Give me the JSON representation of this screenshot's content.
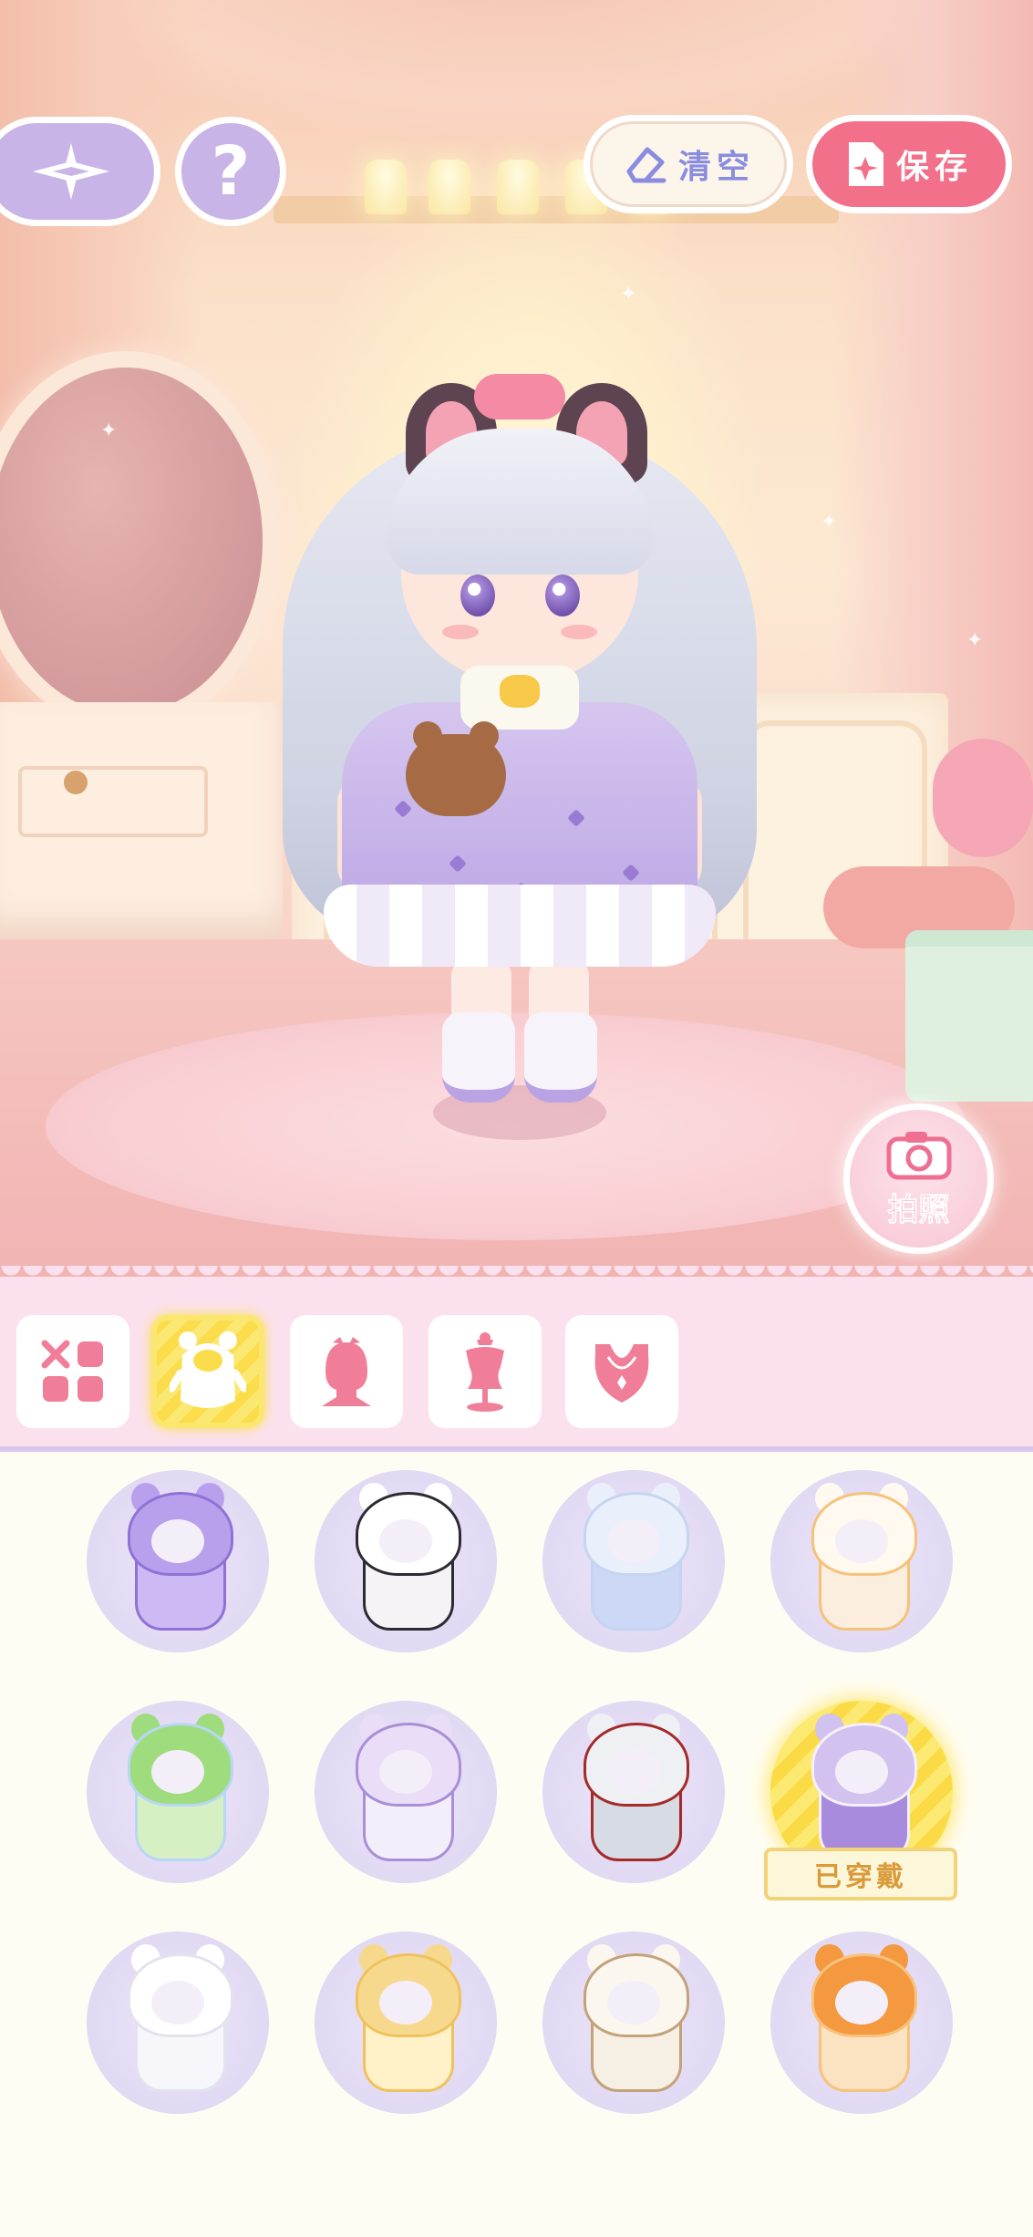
{
  "toolbar": {
    "back_icon": "compass-star-icon",
    "help_label": "?",
    "clear_label": "清空",
    "clear_icon": "eraser-icon",
    "save_label": "保存",
    "save_icon": "document-icon"
  },
  "camera": {
    "label": "拍照",
    "icon": "camera-icon"
  },
  "categories": [
    {
      "name": "all",
      "icon": "grid-icon",
      "active": false
    },
    {
      "name": "costume",
      "icon": "onesie-icon",
      "active": true
    },
    {
      "name": "hair",
      "icon": "hair-bust-icon",
      "active": false
    },
    {
      "name": "dress",
      "icon": "mannequin-icon",
      "active": false
    },
    {
      "name": "accessory",
      "icon": "necklace-bust-icon",
      "active": false
    }
  ],
  "items": [
    {
      "name": "purple-ghost-hood",
      "colors": [
        "#b9a0ec",
        "#8f72d6",
        "#cdb9f4"
      ]
    },
    {
      "name": "panda-magician",
      "colors": [
        "#ffffff",
        "#2d2a33",
        "#f5f3f6"
      ]
    },
    {
      "name": "white-cat-cloak",
      "colors": [
        "#e9f0fb",
        "#c6d5ef",
        "#cdd8f6"
      ]
    },
    {
      "name": "calico-cat-onesie",
      "colors": [
        "#fff9f0",
        "#f6c27a",
        "#fbeedf"
      ]
    },
    {
      "name": "frog-onesie",
      "colors": [
        "#9fdc7e",
        "#b8d7f4",
        "#d6f0c3"
      ]
    },
    {
      "name": "hamster-onesie",
      "colors": [
        "#e9ddf7",
        "#a98fd7",
        "#f3effa"
      ]
    },
    {
      "name": "red-hood-wolf",
      "colors": [
        "#eef0f4",
        "#a52a2a",
        "#d7dbe3"
      ]
    },
    {
      "name": "lolita-dress",
      "colors": [
        "#d2c2ef",
        "#f6f0fb",
        "#a88bdc"
      ],
      "equipped": true
    },
    {
      "name": "white-bunny-onesie",
      "colors": [
        "#ffffff",
        "#e2e3ee",
        "#f6f6fb"
      ]
    },
    {
      "name": "yellow-bear-onesie",
      "colors": [
        "#f7d98d",
        "#f0c25f",
        "#fff2c8"
      ]
    },
    {
      "name": "puppy-gentleman",
      "colors": [
        "#fbf7ef",
        "#c3a27a",
        "#f6efe4"
      ]
    },
    {
      "name": "fox-onesie",
      "colors": [
        "#f4993f",
        "#f7c27c",
        "#fbe3c2"
      ]
    }
  ],
  "equipped_label": "已穿戴",
  "colors": {
    "accent_pink": "#f2708a",
    "accent_purple": "#c9b4e8",
    "active_yellow": "#fbdc4a",
    "category_bg": "#fbe1ee"
  }
}
